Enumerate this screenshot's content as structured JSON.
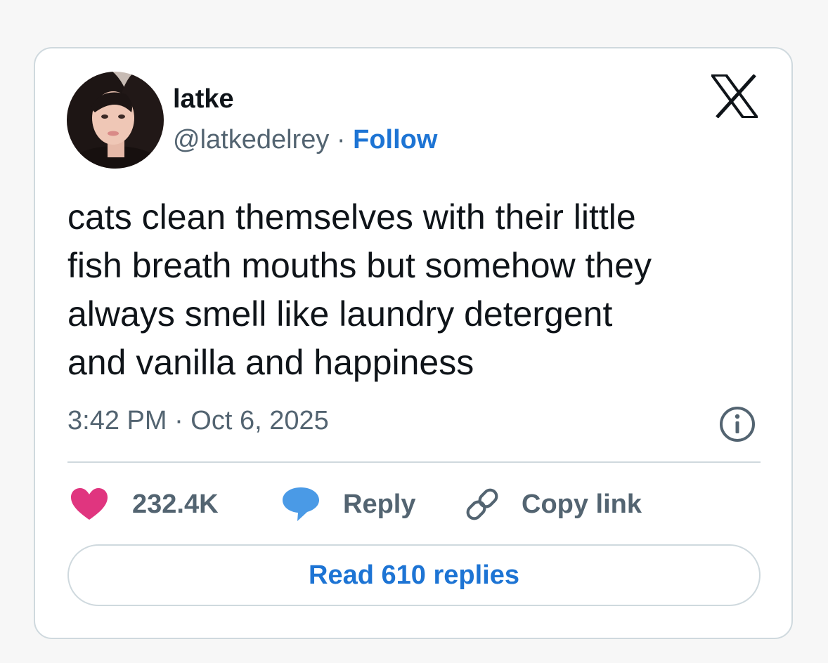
{
  "tweet": {
    "author_name": "latke",
    "handle": "@latkedelrey",
    "separator": " · ",
    "follow_label": "Follow",
    "text": "cats clean themselves with their little\nfish breath mouths but somehow they\nalways smell like laundry detergent\nand vanilla and happiness",
    "timestamp": "3:42 PM · Oct 6, 2025",
    "avatar_icon": "user-photo",
    "platform_icon": "x-logo"
  },
  "actions": {
    "like_count": "232.4K",
    "like_icon": "heart-icon",
    "reply_label": "Reply",
    "reply_icon": "speech-bubble-icon",
    "copy_link_label": "Copy link",
    "copy_link_icon": "link-icon",
    "info_icon": "info-icon"
  },
  "footer": {
    "read_replies_label": "Read 610 replies"
  },
  "colors": {
    "page_background": "#f7f7f7",
    "card_background": "#ffffff",
    "border": "#cfd9de",
    "text_primary": "#0f1419",
    "text_secondary": "#536471",
    "link_blue": "#1d74d4",
    "heart_pink": "#e0357f",
    "reply_blue": "#4a9ae6"
  }
}
